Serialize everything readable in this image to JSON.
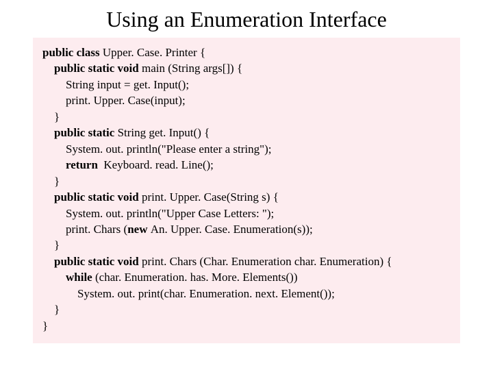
{
  "title": "Using an Enumeration Interface",
  "code": {
    "l1a": "public class ",
    "l1b": "Upper. Case. Printer {",
    "l2a": "public static void ",
    "l2b": "main (String args[]) {",
    "l3": "String input = get. Input();",
    "l4": "print. Upper. Case(input);",
    "l5": "}",
    "l6a": "public static ",
    "l6b": "String get. Input() {",
    "l7": "System. out. println(\"Please enter a string\");",
    "l8a": "return  ",
    "l8b": "Keyboard. read. Line();",
    "l9": "}",
    "l10a": "public static void ",
    "l10b": "print. Upper. Case(String s) {",
    "l11": "System. out. println(\"Upper Case Letters: \");",
    "l12a": "print. Chars (",
    "l12b": "new ",
    "l12c": "An. Upper. Case. Enumeration(s));",
    "l13": "}",
    "l14a": "public static void ",
    "l14b": "print. Chars (Char. Enumeration char. Enumeration) {",
    "l15a": "while ",
    "l15b": "(char. Enumeration. has. More. Elements())",
    "l16": "System. out. print(char. Enumeration. next. Element());",
    "l17": "}",
    "l18": "}"
  }
}
